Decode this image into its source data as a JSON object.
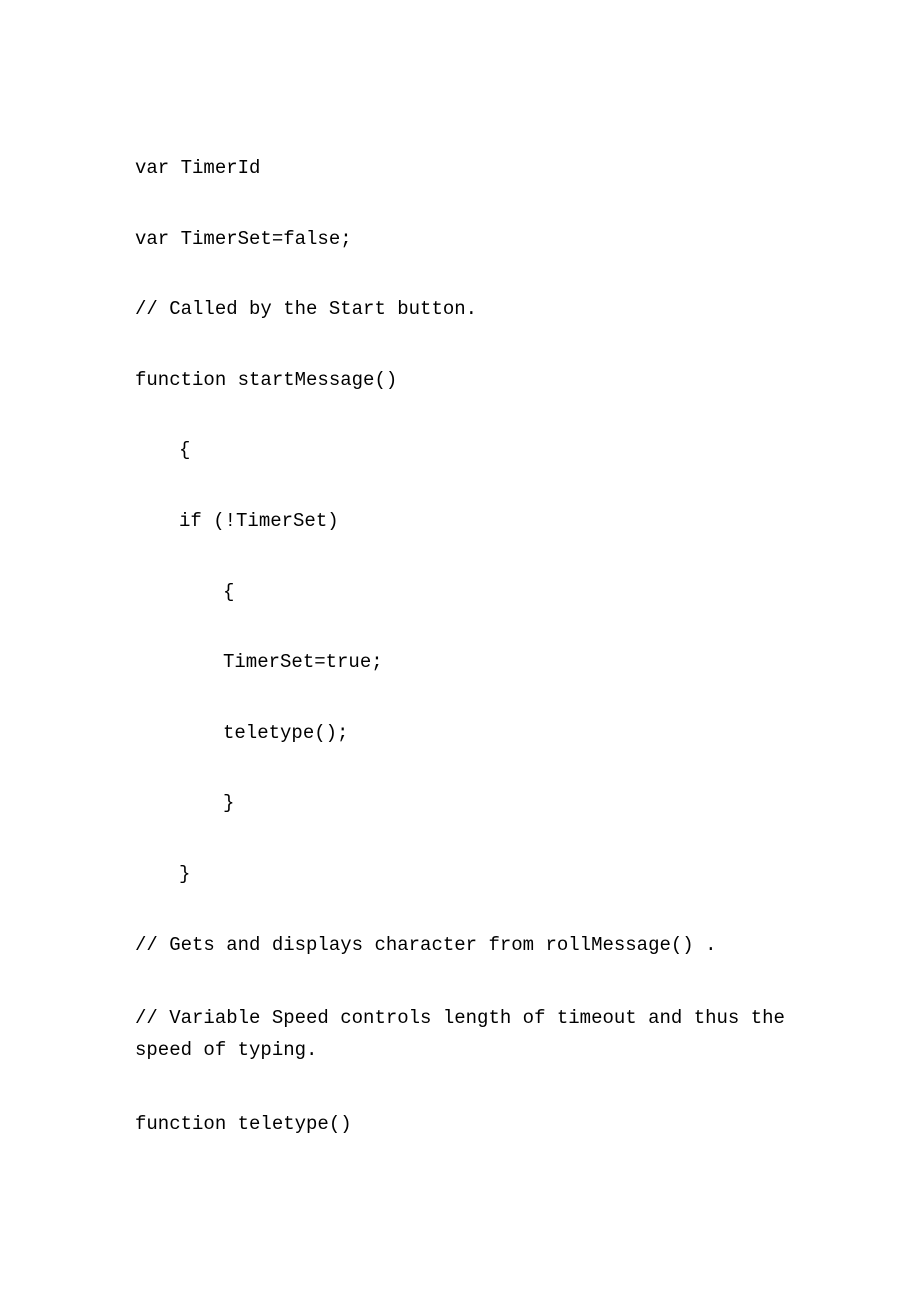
{
  "lines": [
    {
      "text": "var TimerId",
      "indent": 0
    },
    {
      "text": "var TimerSet=false;",
      "indent": 0
    },
    {
      "text": "",
      "indent": 0
    },
    {
      "text": "// Called by the Start button.",
      "indent": 0
    },
    {
      "text": "function startMessage()",
      "indent": 0
    },
    {
      "text": "{",
      "indent": 1
    },
    {
      "text": "if (!TimerSet)",
      "indent": 1
    },
    {
      "text": "{",
      "indent": 2
    },
    {
      "text": "TimerSet=true;",
      "indent": 2
    },
    {
      "text": "teletype();",
      "indent": 2
    },
    {
      "text": "}",
      "indent": 2
    },
    {
      "text": "}",
      "indent": 1
    },
    {
      "text": "",
      "indent": 0
    },
    {
      "text": "// Gets and displays character from rollMessage() .",
      "indent": 0
    },
    {
      "text": "// Variable Speed controls length of timeout and thus the speed of typing.",
      "indent": 0,
      "wrap": true
    },
    {
      "text": "function teletype()",
      "indent": 0
    }
  ]
}
